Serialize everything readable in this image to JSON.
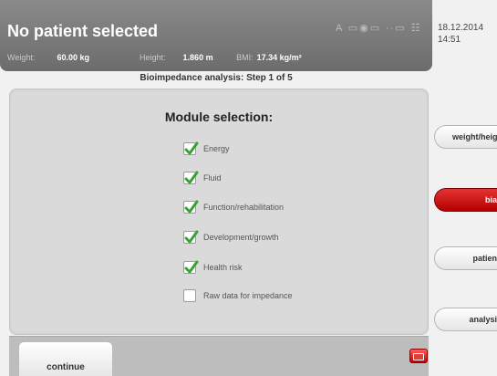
{
  "header": {
    "title": "No patient selected",
    "status_icons_text": "A ▭◉▭ ∙∙▭ ☷",
    "weight_label": "Weight:",
    "weight_value": "60.00 kg",
    "height_label": "Height:",
    "height_value": "1.860 m",
    "bmi_label": "BMI:",
    "bmi_value": "17.34 kg/m²"
  },
  "datetime": {
    "date": "18.12.2014",
    "time": "14:51"
  },
  "step_title": "Bioimpedance analysis: Step 1 of 5",
  "panel": {
    "heading": "Module selection:",
    "options": [
      {
        "label": "Energy",
        "checked": true
      },
      {
        "label": "Fluid",
        "checked": true
      },
      {
        "label": "Function/rehabilitation",
        "checked": true
      },
      {
        "label": "Development/growth",
        "checked": true
      },
      {
        "label": "Health risk",
        "checked": true
      },
      {
        "label": "Raw data for impedance",
        "checked": false
      }
    ]
  },
  "bottom": {
    "continue_label": "continue"
  },
  "side_menu": [
    {
      "label": "weight/heigh",
      "active": false
    },
    {
      "label": "bia",
      "active": true
    },
    {
      "label": "patien",
      "active": false
    },
    {
      "label": "analysi",
      "active": false
    }
  ],
  "colors": {
    "accent_red": "#c80000",
    "check_green": "#3aa234",
    "header_gray": "#7a7a7a"
  }
}
